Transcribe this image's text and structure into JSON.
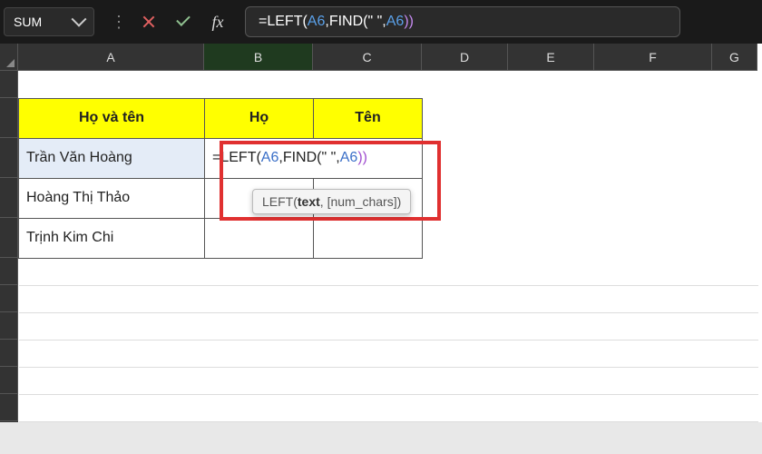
{
  "toolbar": {
    "name_box": "SUM",
    "formula_prefix": "=LEFT(",
    "formula_ref1": "A6",
    "formula_mid": ",FIND(\" \",",
    "formula_ref2": "A6",
    "formula_close": "))",
    "fx_label": "fx"
  },
  "columns": {
    "A": "A",
    "B": "B",
    "C": "C",
    "D": "D",
    "E": "E",
    "F": "F",
    "G": "G"
  },
  "headers": {
    "name": "Họ và tên",
    "ho": "Họ",
    "ten": "Tên"
  },
  "rows": [
    {
      "name": "Trần Văn Hoàng"
    },
    {
      "name": "Hoàng Thị Thảo"
    },
    {
      "name": "Trịnh Kim Chi"
    }
  ],
  "cell_formula": {
    "prefix": "=LEFT(",
    "ref1": "A6",
    "mid": ",FIND(\" \",",
    "ref2": "A6",
    "close": "))"
  },
  "tooltip": {
    "fn": "LEFT(",
    "arg1": "text",
    "rest": ", [num_chars])"
  }
}
